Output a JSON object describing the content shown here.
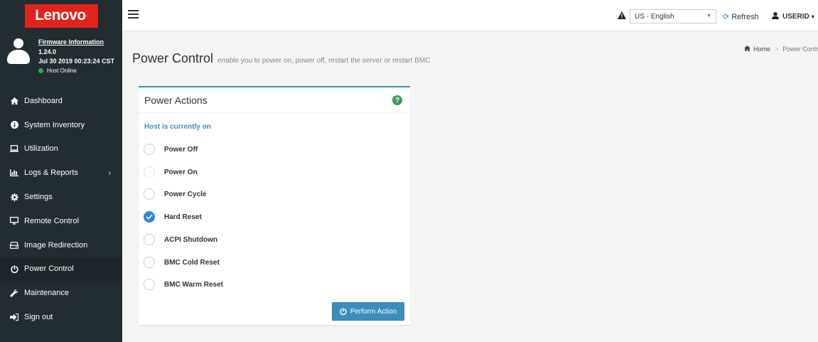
{
  "brand": {
    "logo_text": "Lenovo"
  },
  "firmware": {
    "title": "Firmware Information",
    "version": "1.24.0",
    "datetime": "Jul 30 2019 00:23:24 CST",
    "host_status": "Host Online"
  },
  "sidebar": {
    "items": [
      {
        "label": "Dashboard",
        "icon": "home-icon"
      },
      {
        "label": "System Inventory",
        "icon": "info-icon"
      },
      {
        "label": "Utilization",
        "icon": "laptop-icon"
      },
      {
        "label": "Logs & Reports",
        "icon": "bar-chart-icon"
      },
      {
        "label": "Settings",
        "icon": "gear-icon"
      },
      {
        "label": "Remote Control",
        "icon": "monitor-icon"
      },
      {
        "label": "Image Redirection",
        "icon": "drive-icon"
      },
      {
        "label": "Power Control",
        "icon": "power-icon"
      },
      {
        "label": "Maintenance",
        "icon": "wrench-icon"
      },
      {
        "label": "Sign out",
        "icon": "sign-out-icon"
      }
    ]
  },
  "header": {
    "language": "US - English",
    "refresh_label": "Refresh",
    "user_label": "USERID"
  },
  "page": {
    "title": "Power Control",
    "subtitle": "enable you to power on, power off, restart the server or restart BMC",
    "breadcrumb_home": "Home",
    "breadcrumb_current": "Power Control"
  },
  "panel": {
    "title": "Power Actions",
    "host_status": "Host is currently on",
    "options": [
      {
        "label": "Power Off",
        "checked": false
      },
      {
        "label": "Power On",
        "checked": false
      },
      {
        "label": "Power Cycle",
        "checked": false
      },
      {
        "label": "Hard Reset",
        "checked": true
      },
      {
        "label": "ACPI Shutdown",
        "checked": false
      },
      {
        "label": "BMC Cold Reset",
        "checked": false
      },
      {
        "label": "BMC Warm Reset",
        "checked": false
      }
    ],
    "button_label": "Perform Action"
  },
  "colors": {
    "sidebar_bg": "#222d32",
    "logo_red": "#e2231a",
    "accent_blue": "#3c8dbc",
    "radio_checked": "#2e86de",
    "online_green": "#2ab14a",
    "help_green": "#3b9e5a"
  }
}
